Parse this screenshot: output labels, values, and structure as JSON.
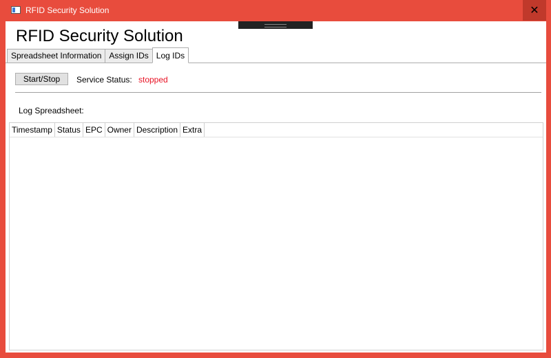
{
  "window": {
    "title": "RFID Security Solution",
    "close_glyph": "✕",
    "accent_color": "#e84c3d"
  },
  "app": {
    "heading": "RFID Security Solution"
  },
  "tabs": [
    {
      "label": "Spreadsheet Information"
    },
    {
      "label": "Assign IDs"
    },
    {
      "label": "Log IDs",
      "active": true
    }
  ],
  "log_tab": {
    "start_stop_label": "Start/Stop",
    "service_status_label": "Service Status:",
    "service_status_value": "stopped",
    "service_status_color": "#e81123",
    "log_spreadsheet_label": "Log Spreadsheet:"
  },
  "grid": {
    "columns": [
      "Timestamp",
      "Status",
      "EPC",
      "Owner",
      "Description",
      "Extra"
    ],
    "rows": []
  }
}
